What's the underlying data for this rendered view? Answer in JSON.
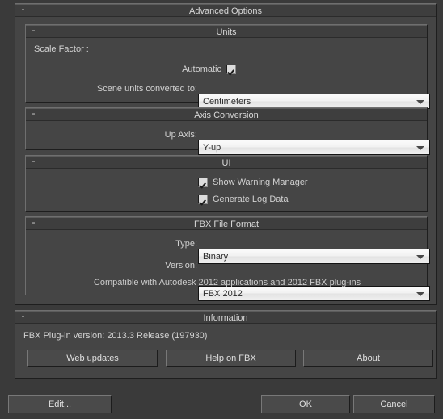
{
  "dialog": {
    "advanced_options": {
      "title": "Advanced Options",
      "collapse_glyph": "-",
      "units": {
        "title": "Units",
        "collapse_glyph": "-",
        "scale_factor_label": "Scale Factor :",
        "automatic_label": "Automatic",
        "automatic_checked": true,
        "scene_units_label": "Scene units converted to:",
        "scene_units_value": "Centimeters"
      },
      "axis_conversion": {
        "title": "Axis Conversion",
        "collapse_glyph": "-",
        "up_axis_label": "Up Axis:",
        "up_axis_value": "Y-up"
      },
      "ui": {
        "title": "UI",
        "collapse_glyph": "-",
        "show_warning_manager_label": "Show Warning Manager",
        "show_warning_manager_checked": true,
        "generate_log_data_label": "Generate Log Data",
        "generate_log_data_checked": true
      },
      "fbx_file_format": {
        "title": "FBX File Format",
        "collapse_glyph": "-",
        "type_label": "Type:",
        "type_value": "Binary",
        "version_label": "Version:",
        "version_value": "FBX 2012",
        "compatibility_note": "Compatible with Autodesk 2012 applications and 2012 FBX plug-ins"
      }
    },
    "information": {
      "title": "Information",
      "collapse_glyph": "-",
      "plugin_version": "FBX Plug-in version: 2013.3 Release (197930)",
      "web_updates_label": "Web updates",
      "help_on_fbx_label": "Help on FBX",
      "about_label": "About"
    },
    "footer": {
      "edit_label": "Edit...",
      "ok_label": "OK",
      "cancel_label": "Cancel"
    }
  },
  "colors": {
    "window_background": "#3a3a3a",
    "panel_background": "#454545",
    "header_background": "#3e3e3e",
    "text": "#d2d2d2",
    "combo_text": "#2a2a2a"
  }
}
